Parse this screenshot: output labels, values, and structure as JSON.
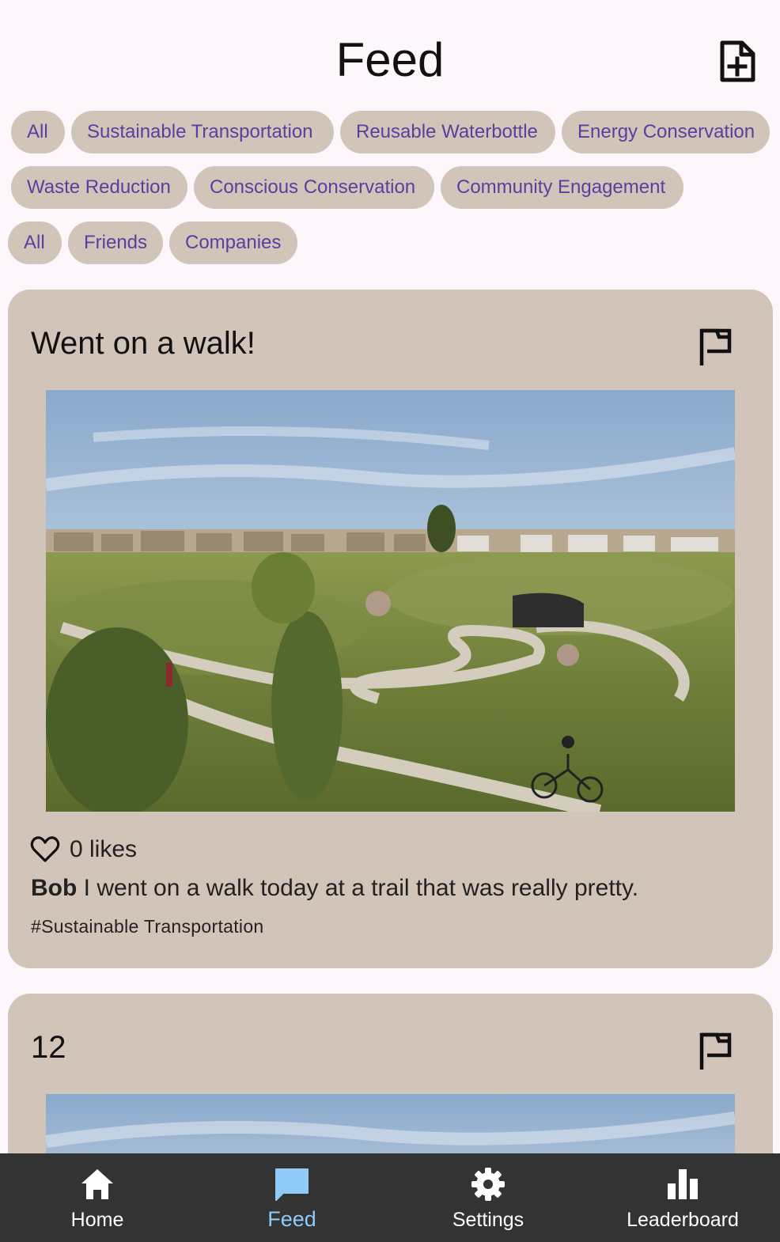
{
  "header": {
    "title": "Feed",
    "new_post_icon": "note-add-icon"
  },
  "filters": {
    "categories": [
      "All",
      "Sustainable Transportation",
      "Reusable Waterbottle",
      "Energy Conservation",
      "Waste Reduction",
      "Conscious Conservation",
      "Community Engagement"
    ],
    "audience": [
      "All",
      "Friends",
      "Companies"
    ]
  },
  "posts": [
    {
      "title": "Went on a walk!",
      "likes_text": "0 likes",
      "author": "Bob",
      "body": " I went on a walk today at a trail that was really pretty.",
      "tag": "#Sustainable Transportation"
    },
    {
      "title": "12"
    }
  ],
  "nav": {
    "items": [
      {
        "label": "Home",
        "icon": "home-icon"
      },
      {
        "label": "Feed",
        "icon": "chat-icon",
        "active": true
      },
      {
        "label": "Settings",
        "icon": "gear-icon"
      },
      {
        "label": "Leaderboard",
        "icon": "bar-chart-icon"
      }
    ]
  },
  "colors": {
    "chip_bg": "#d1c4b8",
    "chip_text": "#5a3fa0",
    "card_bg": "#d1c4b8",
    "nav_bg": "#333334",
    "nav_active": "#8fcbf6",
    "page_bg": "#fdf7fc"
  }
}
